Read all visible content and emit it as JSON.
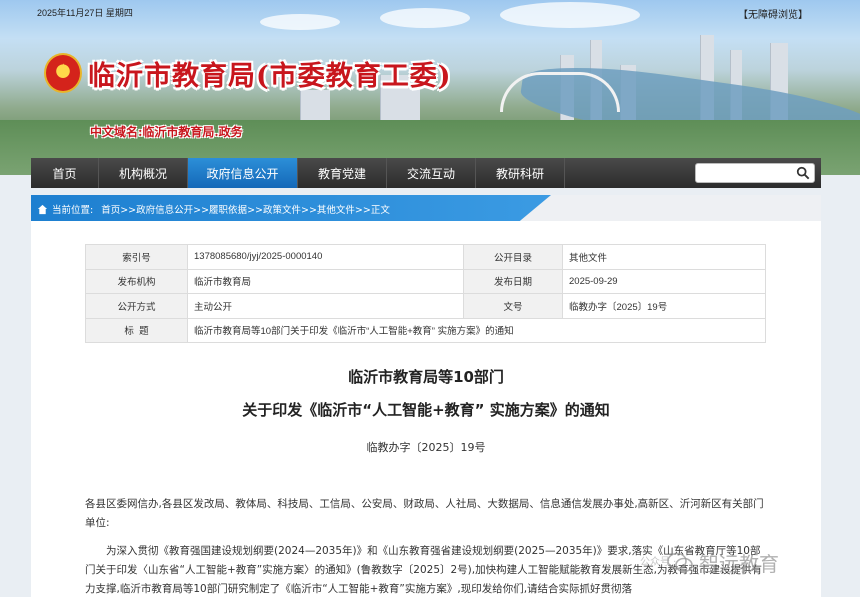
{
  "header": {
    "date": "2025年11月27日 星期四",
    "accessibility": "【无障碍浏览】",
    "site_title": "临沂市教育局(市委教育工委)",
    "domain": "中文域名:临沂市教育局.政务"
  },
  "nav": {
    "items": [
      "首页",
      "机构概况",
      "政府信息公开",
      "教育党建",
      "交流互动",
      "教研科研"
    ],
    "active_index": 2,
    "search_placeholder": ""
  },
  "breadcrumb": {
    "label": "当前位置:",
    "items": [
      "首页",
      ">>政府信息公开",
      ">>履职依据",
      ">>政策文件",
      ">>其他文件",
      ">>正文"
    ]
  },
  "meta": {
    "index_label": "索引号",
    "index_value": "1378085680/jyj/2025-0000140",
    "catalog_label": "公开目录",
    "catalog_value": "其他文件",
    "issuer_label": "发布机构",
    "issuer_value": "临沂市教育局",
    "date_label": "发布日期",
    "date_value": "2025-09-29",
    "mode_label": "公开方式",
    "mode_value": "主动公开",
    "docno_label": "文号",
    "docno_value": "临教办字〔2025〕19号",
    "title_label": "标  题",
    "title_value": "临沂市教育局等10部门关于印发《临沂市“人工智能+教育” 实施方案》的通知"
  },
  "article": {
    "title_line1": "临沂市教育局等10部门",
    "title_line2": "关于印发《临沂市“人工智能+教育” 实施方案》的通知",
    "doc_number": "临教办字〔2025〕19号",
    "para1": "各县区委网信办,各县区发改局、教体局、科技局、工信局、公安局、财政局、人社局、大数据局、信息通信发展办事处,高新区、沂河新区有关部门单位:",
    "para2": "为深入贯彻《教育强国建设规划纲要(2024—2035年)》和《山东教育强省建设规划纲要(2025—2035年)》要求,落实《山东省教育厅等10部门关于印发〈山东省“人工智能+教育”实施方案〉的通知》(鲁教数字〔2025〕2号),加快构建人工智能赋能教育发展新生态,为教育强市建设提供有力支撑,临沂市教育局等10部门研究制定了《临沂市“人工智能+教育”实施方案》,现印发给你们,请结合实际抓好贯彻落"
  },
  "watermark": {
    "text": "智远教育",
    "small_text": "公众号 ·"
  },
  "colors": {
    "title_red": "#c8161d",
    "nav_active": "#1d7fd0",
    "nav_bg": "#333333"
  }
}
